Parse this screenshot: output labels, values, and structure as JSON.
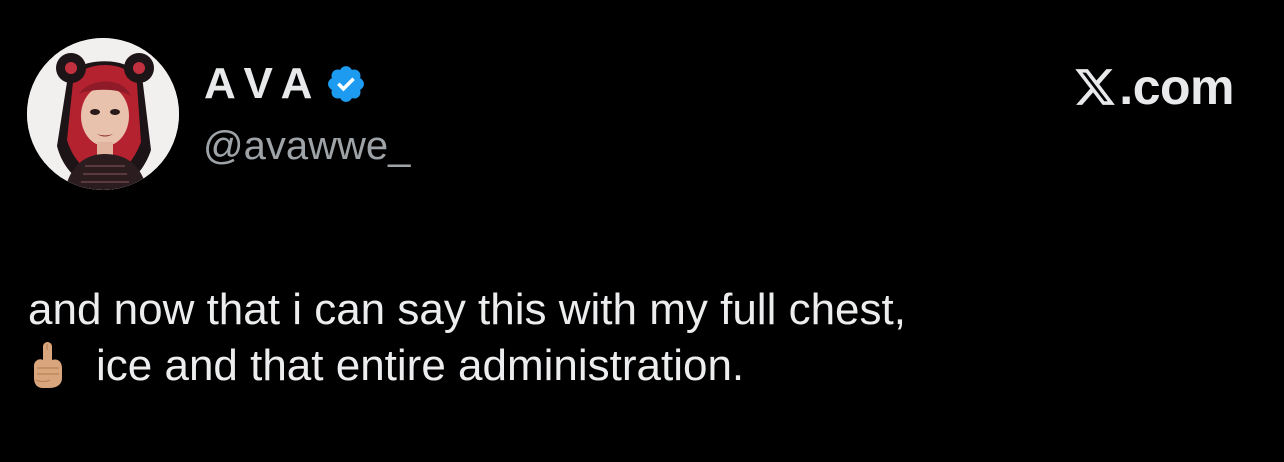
{
  "user": {
    "display_name": "AVA",
    "handle": "@avawwe_",
    "verified": true,
    "avatar_icon": "avatar-illustration"
  },
  "site": {
    "label": ".com",
    "logo_icon": "x-logo-icon"
  },
  "tweet": {
    "line1": "and now that i can say this with my full chest,",
    "emoji_icon": "middle-finger-emoji-icon",
    "line2": "ice and that entire administration."
  },
  "colors": {
    "background": "#000000",
    "text": "#e7e9ea",
    "secondary_text": "#9ea3a8",
    "verified_badge": "#1d9bf0"
  }
}
